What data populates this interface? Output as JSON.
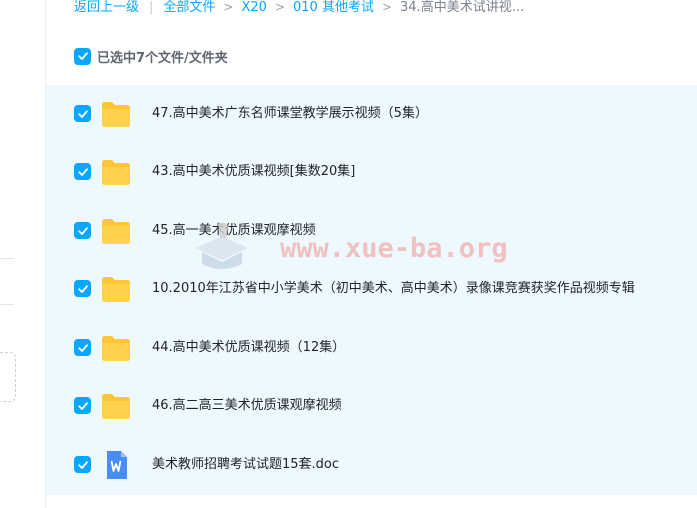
{
  "breadcrumb": {
    "back": "返回上一级",
    "all_files": "全部文件",
    "crumbs": [
      "X20",
      "010 其他考试"
    ],
    "current": "34.高中美术试讲视..."
  },
  "selection": {
    "summary": "已选中7个文件/文件夹"
  },
  "files": [
    {
      "name": "47.高中美术广东名师课堂教学展示视频（5集）",
      "type": "folder"
    },
    {
      "name": "43.高中美术优质课视频[集数20集]",
      "type": "folder"
    },
    {
      "name": "45.高一美术优质课观摩视频",
      "type": "folder"
    },
    {
      "name": "10.2010年江苏省中小学美术（初中美术、高中美术）录像课竞赛获奖作品视频专辑",
      "type": "folder"
    },
    {
      "name": "44.高中美术优质课视频（12集）",
      "type": "folder"
    },
    {
      "name": "46.高二高三美术优质课观摩视频",
      "type": "folder"
    },
    {
      "name": "美术教师招聘考试试题15套.doc",
      "type": "doc"
    }
  ],
  "watermark": "www.xue-ba.org",
  "colors": {
    "accent": "#06a7ff",
    "folder": "#ffc533",
    "row_bg": "#eef8ff",
    "doc": "#4a8cf7"
  }
}
